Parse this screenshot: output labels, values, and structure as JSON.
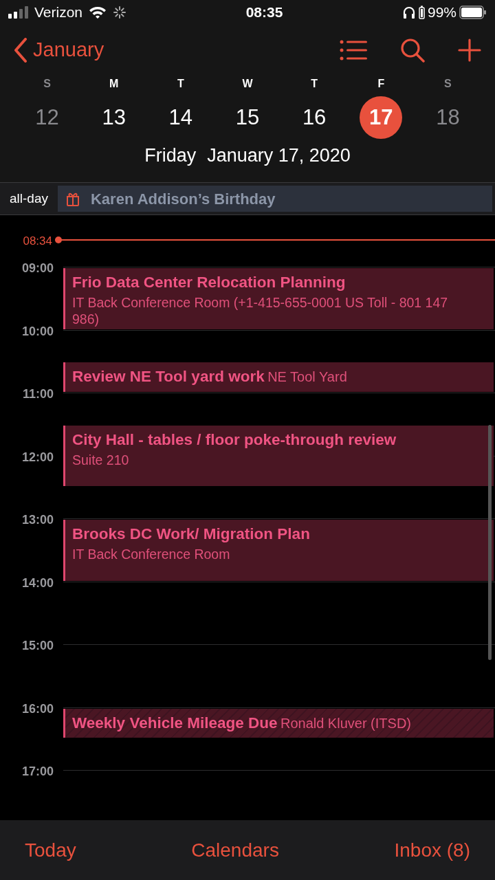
{
  "status_bar": {
    "carrier": "Verizon",
    "time": "08:35",
    "battery": "99%"
  },
  "nav": {
    "back": "January"
  },
  "week": [
    {
      "letter": "S",
      "day": "12",
      "selected": false,
      "weekend": true
    },
    {
      "letter": "M",
      "day": "13",
      "selected": false,
      "weekend": false
    },
    {
      "letter": "T",
      "day": "14",
      "selected": false,
      "weekend": false
    },
    {
      "letter": "W",
      "day": "15",
      "selected": false,
      "weekend": false
    },
    {
      "letter": "T",
      "day": "16",
      "selected": false,
      "weekend": false
    },
    {
      "letter": "F",
      "day": "17",
      "selected": true,
      "weekend": false
    },
    {
      "letter": "S",
      "day": "18",
      "selected": false,
      "weekend": true
    }
  ],
  "date_title": {
    "weekday": "Friday",
    "date": "January 17, 2020"
  },
  "all_day": {
    "label": "all-day",
    "event": "Karen Addison’s Birthday"
  },
  "now": {
    "time": "08:34"
  },
  "hours": [
    {
      "label": "09:00",
      "events": [
        {
          "title": "Frio Data Center Relocation Planning",
          "location": "IT Back Conference Room (+1-415-655-0001 US Toll - 801 147 986)",
          "kind": "hour",
          "late_start": false,
          "inline": false,
          "striped": false
        }
      ]
    },
    {
      "label": "10:00",
      "events": [
        {
          "title": "Review NE Tool yard work",
          "location": "NE Tool Yard",
          "kind": "half",
          "late_start": true,
          "inline": true,
          "striped": false
        }
      ]
    },
    {
      "label": "11:00",
      "events": [
        {
          "title": "City Hall - tables / floor poke-through review",
          "location": "Suite 210",
          "kind": "hour",
          "late_start": true,
          "inline": false,
          "striped": false
        }
      ]
    },
    {
      "label": "12:00"
    },
    {
      "label": "13:00",
      "events": [
        {
          "title": "Brooks DC Work/ Migration Plan",
          "location": "IT Back Conference Room",
          "kind": "hour",
          "late_start": false,
          "inline": false,
          "striped": false
        }
      ]
    },
    {
      "label": "14:00"
    },
    {
      "label": "15:00"
    },
    {
      "label": "16:00",
      "events": [
        {
          "title": "Weekly Vehicle Mileage Due",
          "location": "Ronald Kluver (ITSD)",
          "kind": "half",
          "late_start": false,
          "inline": true,
          "striped": true
        }
      ]
    },
    {
      "label": "17:00"
    }
  ],
  "tab_bar": [
    "Today",
    "Calendars",
    "Inbox (8)"
  ]
}
